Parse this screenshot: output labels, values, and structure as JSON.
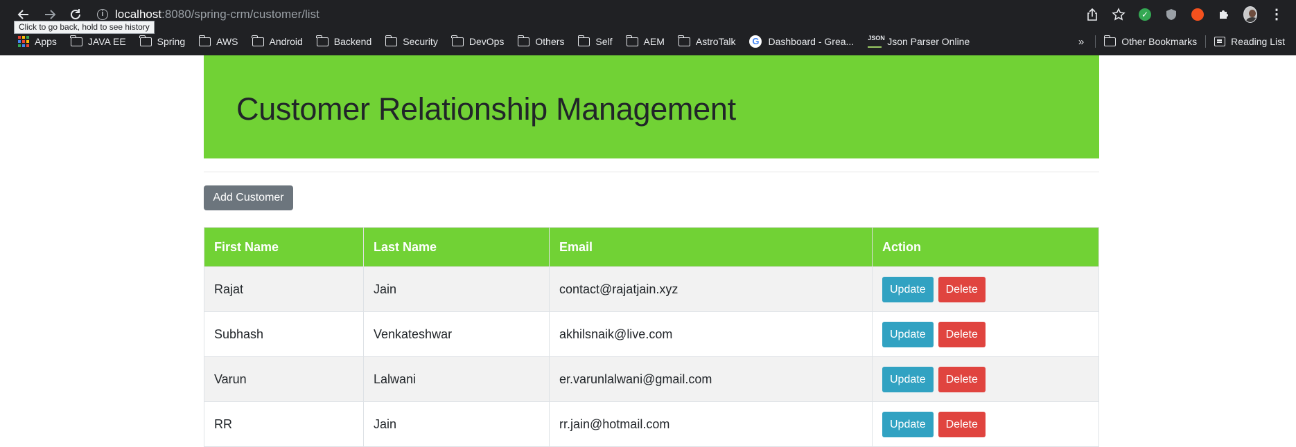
{
  "browser": {
    "url_host": "localhost",
    "url_rest": ":8080/spring-crm/customer/list",
    "tooltip": "Click to go back, hold to see history",
    "bookmarks": [
      {
        "label": "Apps",
        "icon": "apps-grid-icon"
      },
      {
        "label": "JAVA EE",
        "icon": "folder-icon"
      },
      {
        "label": "Spring",
        "icon": "folder-icon"
      },
      {
        "label": "AWS",
        "icon": "folder-icon"
      },
      {
        "label": "Android",
        "icon": "folder-icon"
      },
      {
        "label": "Backend",
        "icon": "folder-icon"
      },
      {
        "label": "Security",
        "icon": "folder-icon"
      },
      {
        "label": "DevOps",
        "icon": "folder-icon"
      },
      {
        "label": "Others",
        "icon": "folder-icon"
      },
      {
        "label": "Self",
        "icon": "folder-icon"
      },
      {
        "label": "AEM",
        "icon": "folder-icon"
      },
      {
        "label": "AstroTalk",
        "icon": "folder-icon"
      },
      {
        "label": "Dashboard - Grea...",
        "icon": "google-icon"
      },
      {
        "label": "Json Parser Online",
        "icon": "json-icon"
      }
    ],
    "overflow_chevron": "»",
    "other_bookmarks": "Other Bookmarks",
    "reading_list": "Reading List",
    "json_icon_text": "JSON",
    "google_icon_text": "G"
  },
  "page": {
    "title": "Customer Relationship Management",
    "add_button": "Add Customer",
    "table": {
      "headers": [
        "First Name",
        "Last Name",
        "Email",
        "Action"
      ],
      "rows": [
        {
          "first": "Rajat",
          "last": "Jain",
          "email": "contact@rajatjain.xyz"
        },
        {
          "first": "Subhash",
          "last": "Venkateshwar",
          "email": "akhilsnaik@live.com"
        },
        {
          "first": "Varun",
          "last": "Lalwani",
          "email": "er.varunlalwani@gmail.com"
        },
        {
          "first": "RR",
          "last": "Jain",
          "email": "rr.jain@hotmail.com"
        }
      ],
      "update_label": "Update",
      "delete_label": "Delete"
    }
  },
  "colors": {
    "header_green": "#71d235",
    "update_blue": "#31a2c2",
    "delete_red": "#e0443f",
    "add_gray": "#6c757d",
    "chrome_dark": "#202124"
  }
}
